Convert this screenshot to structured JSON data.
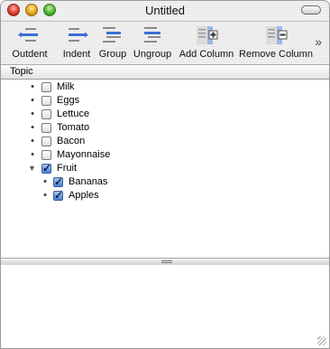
{
  "window": {
    "title": "Untitled"
  },
  "toolbar": {
    "buttons": [
      {
        "label": "Outdent"
      },
      {
        "label": "Indent"
      },
      {
        "label": "Group"
      },
      {
        "label": "Ungroup"
      },
      {
        "label": "Add Column"
      },
      {
        "label": "Remove Column"
      }
    ],
    "overflow": "»"
  },
  "outline": {
    "column_header": "Topic",
    "items": [
      {
        "label": "Milk",
        "checked": false,
        "level": 0
      },
      {
        "label": "Eggs",
        "checked": false,
        "level": 0
      },
      {
        "label": "Lettuce",
        "checked": false,
        "level": 0
      },
      {
        "label": "Tomato",
        "checked": false,
        "level": 0
      },
      {
        "label": "Bacon",
        "checked": false,
        "level": 0
      },
      {
        "label": "Mayonnaise",
        "checked": false,
        "level": 0
      },
      {
        "label": "Fruit",
        "checked": true,
        "level": 0,
        "expanded": true
      },
      {
        "label": "Bananas",
        "checked": true,
        "level": 1
      },
      {
        "label": "Apples",
        "checked": true,
        "level": 1
      }
    ]
  },
  "icons": {
    "close": "close-button-red",
    "minimize": "minimize-button-yellow",
    "zoom": "zoom-button-green",
    "toolbar_toggle": "toolbar-pill"
  }
}
